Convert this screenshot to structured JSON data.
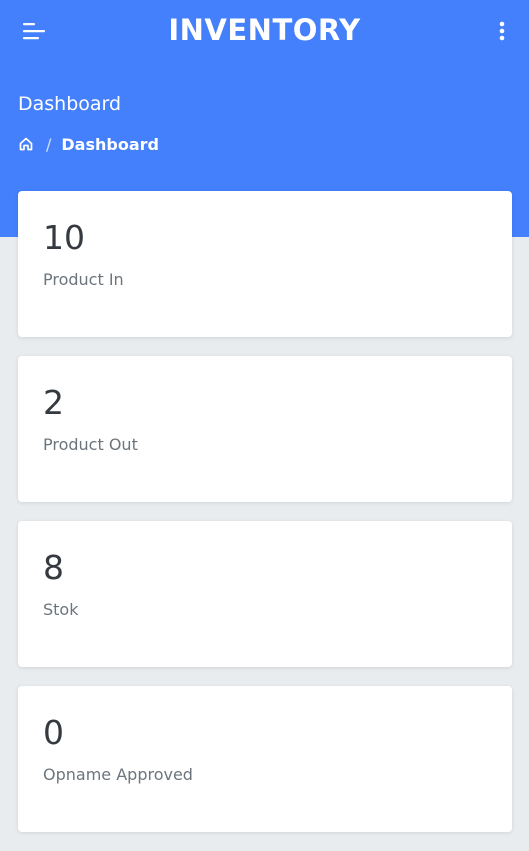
{
  "app": {
    "title": "INVENTORY",
    "colors": {
      "primary": "#4480fc",
      "background": "#e9ecef",
      "card": "#ffffff"
    }
  },
  "topbar": {
    "menu_icon": "hamburger-menu-icon",
    "options_icon": "kebab-menu-icon"
  },
  "page": {
    "title": "Dashboard"
  },
  "breadcrumb": {
    "home_icon": "home-icon",
    "separator": "/",
    "current": "Dashboard"
  },
  "cards": [
    {
      "value": "10",
      "label": "Product In"
    },
    {
      "value": "2",
      "label": "Product Out"
    },
    {
      "value": "8",
      "label": "Stok"
    },
    {
      "value": "0",
      "label": "Opname Approved"
    }
  ]
}
